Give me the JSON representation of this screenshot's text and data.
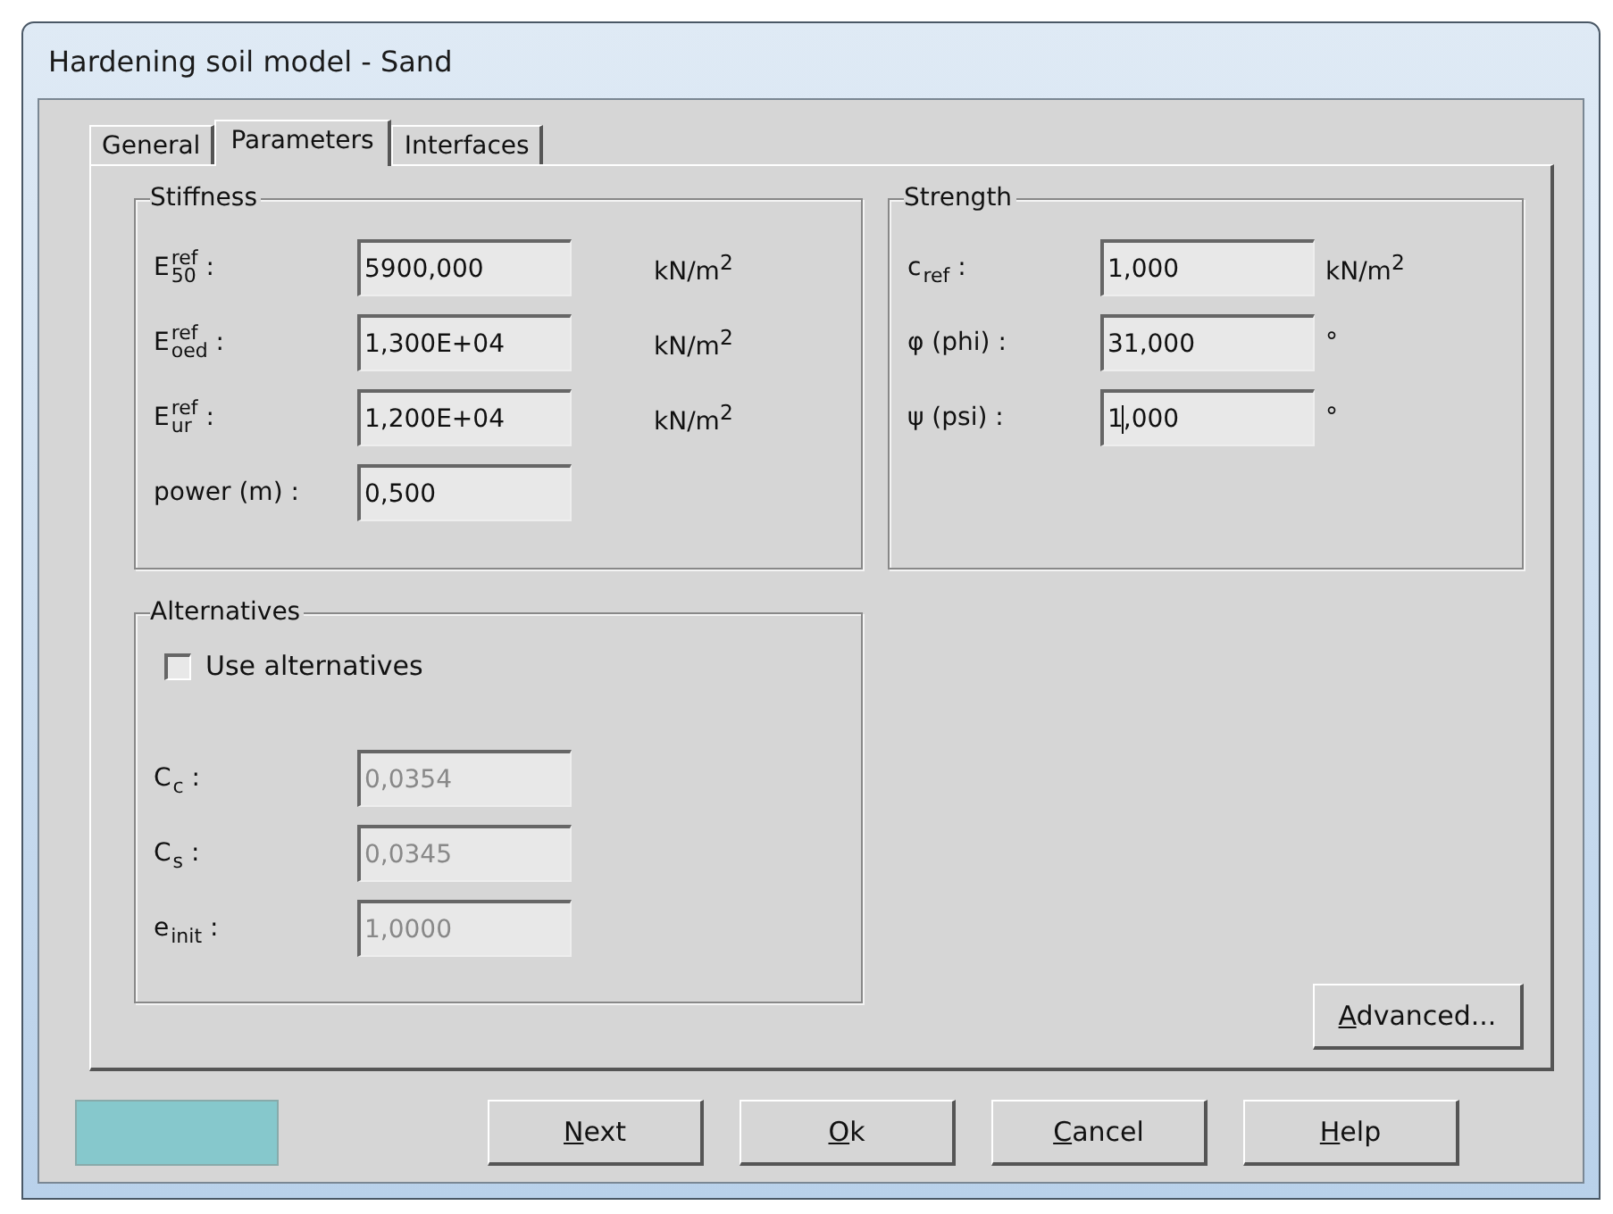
{
  "window": {
    "title": "Hardening soil model - Sand"
  },
  "tabs": [
    {
      "label": "General",
      "selected": false
    },
    {
      "label": "Parameters",
      "selected": true
    },
    {
      "label": "Interfaces",
      "selected": false
    }
  ],
  "stiffness": {
    "title": "Stiffness",
    "rows": [
      {
        "symbol": "E",
        "sup": "ref",
        "sub": "50",
        "suffix": " :",
        "value": "5900,000",
        "unit": "kN/m$^{2}$"
      },
      {
        "symbol": "E",
        "sup": "ref",
        "sub": "oed",
        "suffix": " :",
        "value": "1,300E+04",
        "unit": "kN/m$^{2}$"
      },
      {
        "symbol": "E",
        "sup": "ref",
        "sub": "ur",
        "suffix": " :",
        "value": "1,200E+04",
        "unit": "kN/m$^{2}$"
      },
      {
        "symbol": "power (m) :",
        "value": "0,500"
      }
    ]
  },
  "strength": {
    "title": "Strength",
    "rows": [
      {
        "symbol": "c",
        "sub": "ref",
        "suffix": " :",
        "value": "1,000",
        "unit": "kN/m$^{2}$"
      },
      {
        "symbol": "φ (phi) :",
        "value": "31,000",
        "unit": "°"
      },
      {
        "symbol": "ψ (psi) :",
        "value": "1,000",
        "unit": "°",
        "focused": true
      }
    ]
  },
  "alternatives": {
    "title": "Alternatives",
    "checkbox": {
      "label": "Use alternatives",
      "checked": false
    },
    "rows": [
      {
        "symbol": "C",
        "sub": "c",
        "suffix": " :",
        "value": "0,0354",
        "disabled": true
      },
      {
        "symbol": "C",
        "sub": "s",
        "suffix": " :",
        "value": "0,0345",
        "disabled": true
      },
      {
        "symbol": "e",
        "sub": "init",
        "suffix": " :",
        "value": "1,0000",
        "disabled": true
      }
    ]
  },
  "advanced_button": {
    "key": "A",
    "rest": "dvanced..."
  },
  "status_swatch": {
    "color": "#86c8cc"
  },
  "buttons": [
    {
      "key": "N",
      "rest": "ext"
    },
    {
      "key": "O",
      "rest": "k"
    },
    {
      "key": "C",
      "rest": "ancel"
    },
    {
      "key": "H",
      "rest": "elp"
    }
  ]
}
